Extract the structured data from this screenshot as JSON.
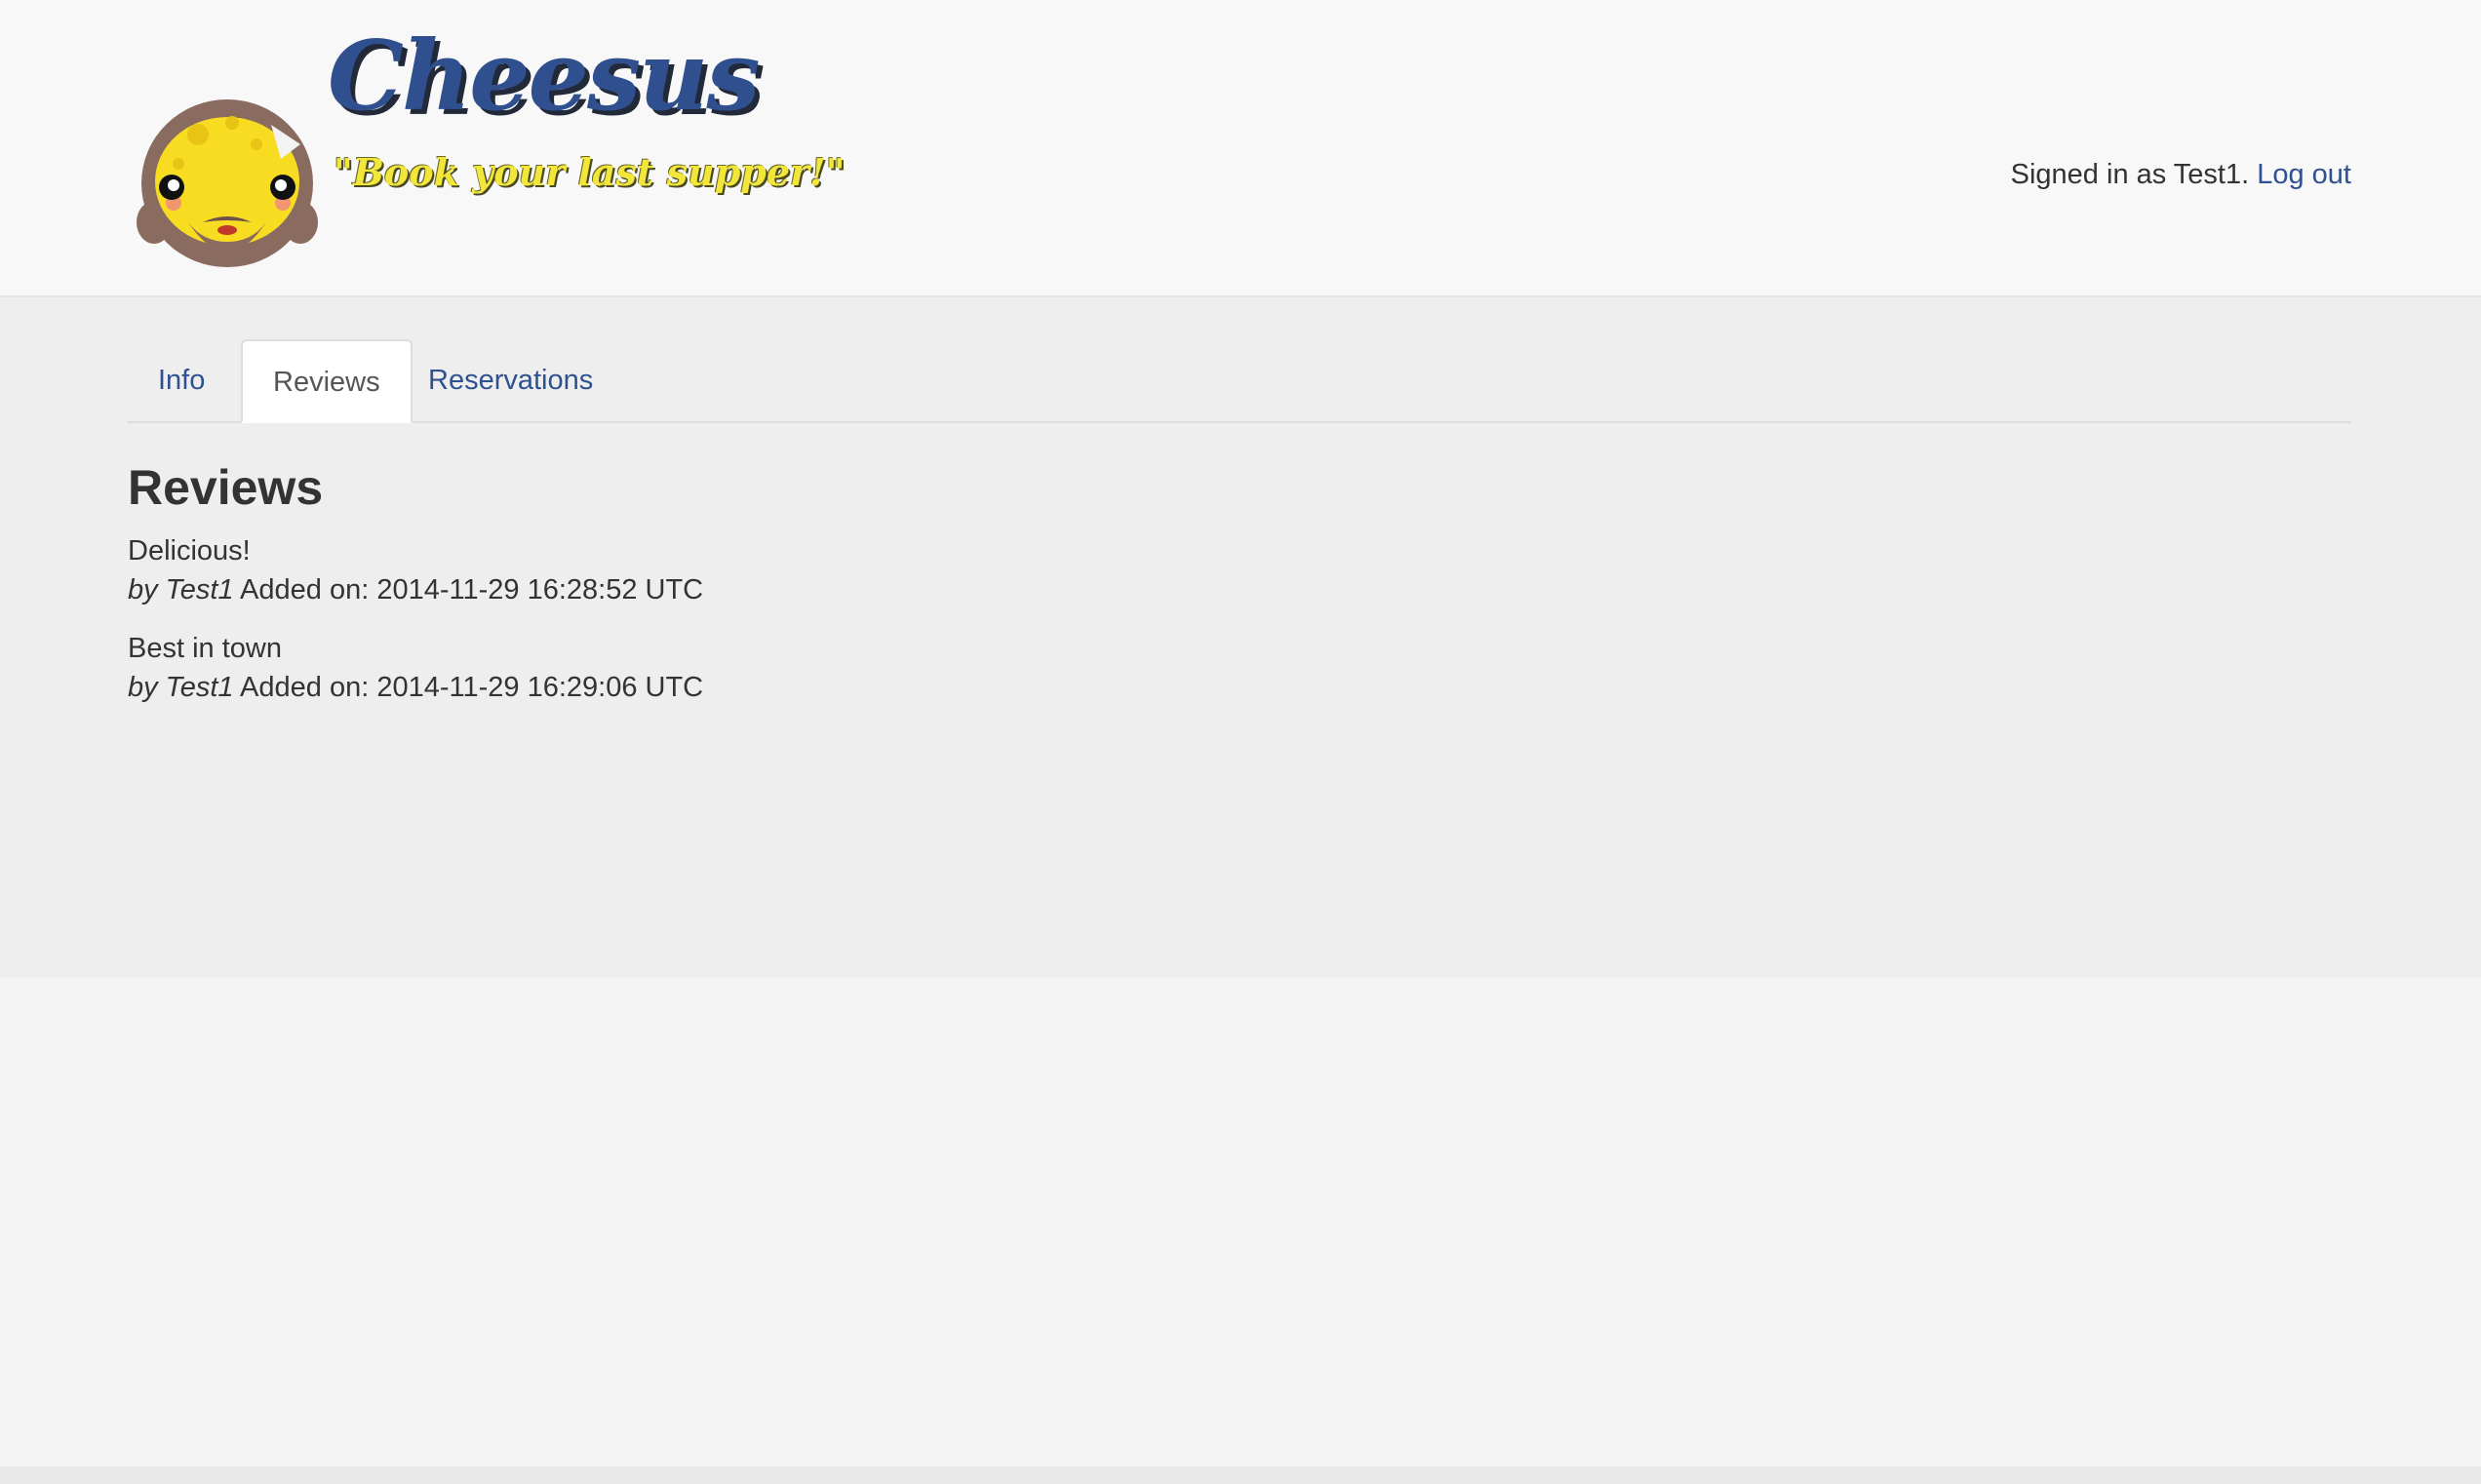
{
  "header": {
    "brand_title": "Cheesus",
    "brand_tagline": "\"Book your last supper!\"",
    "signed_in_text": "Signed in as Test1.",
    "logout_label": "Log out",
    "logo_icon": "cheese-jesus-logo-icon"
  },
  "tabs": [
    {
      "label": "Info",
      "active": false
    },
    {
      "label": "Reviews",
      "active": true
    },
    {
      "label": "Reservations",
      "active": false
    }
  ],
  "reviews": {
    "heading": "Reviews",
    "items": [
      {
        "text": "Delicious!",
        "author": "by Test1",
        "added": "Added on: 2014-11-29 16:28:52 UTC"
      },
      {
        "text": "Best in town",
        "author": "by Test1",
        "added": "Added on: 2014-11-29 16:29:06 UTC"
      }
    ]
  },
  "colors": {
    "link": "#2f5192",
    "brand_blue": "#2f4f8e",
    "tagline_yellow": "#f3e63a",
    "header_bg": "#f8f8f8",
    "main_bg": "#eeeeee"
  }
}
